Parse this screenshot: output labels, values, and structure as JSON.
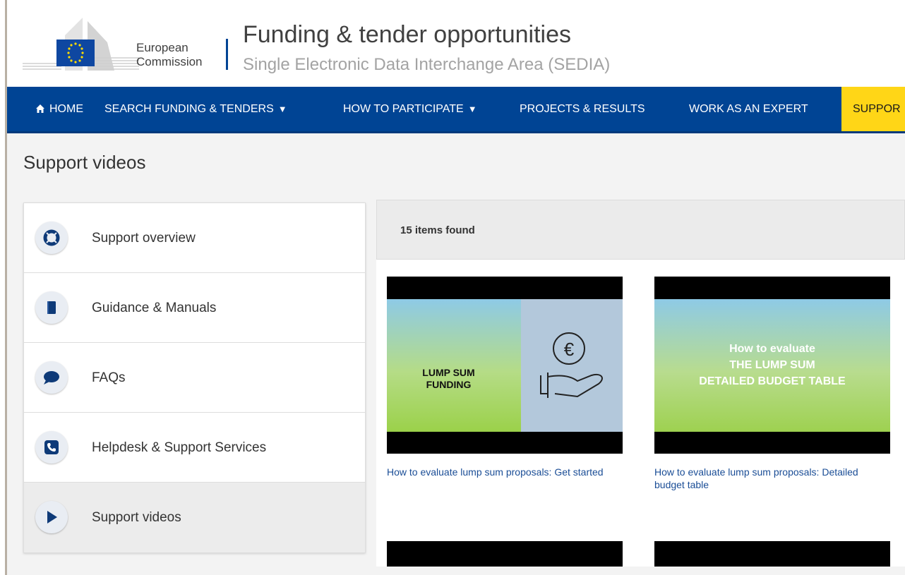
{
  "header": {
    "org_line1": "European",
    "org_line2": "Commission",
    "title": "Funding & tender opportunities",
    "subtitle": "Single Electronic Data Interchange Area (SEDIA)"
  },
  "nav": {
    "home": "HOME",
    "search": "SEARCH FUNDING & TENDERS",
    "participate": "HOW TO PARTICIPATE",
    "projects": "PROJECTS & RESULTS",
    "expert": "WORK AS AN EXPERT",
    "support": "SUPPOR"
  },
  "page": {
    "title": "Support videos"
  },
  "sidebar": {
    "items": [
      {
        "label": "Support overview",
        "icon": "lifebuoy-icon"
      },
      {
        "label": "Guidance & Manuals",
        "icon": "book-icon"
      },
      {
        "label": "FAQs",
        "icon": "speech-bubble-icon"
      },
      {
        "label": "Helpdesk & Support Services",
        "icon": "phone-icon"
      },
      {
        "label": "Support videos",
        "icon": "play-icon"
      }
    ]
  },
  "results": {
    "count_text": "15 items found",
    "videos": [
      {
        "thumb_title_line1": "LUMP SUM",
        "thumb_title_line2": "FUNDING",
        "title": "How to evaluate lump sum proposals: Get started"
      },
      {
        "thumb_line1": "How to evaluate",
        "thumb_line2": "THE LUMP SUM",
        "thumb_line3": "DETAILED BUDGET TABLE",
        "title": "How to evaluate lump sum proposals: Detailed budget table"
      }
    ]
  },
  "colors": {
    "nav_bg": "#004494",
    "support_tab": "#ffd617",
    "link": "#1a4d96"
  }
}
